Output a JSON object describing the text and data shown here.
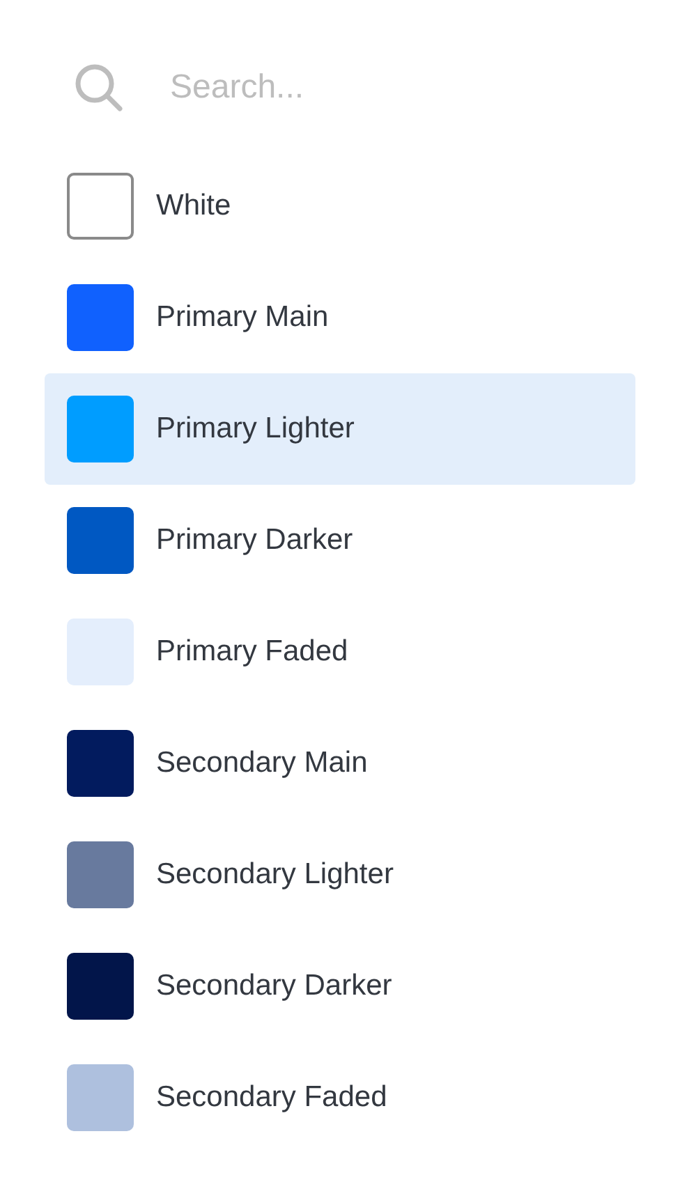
{
  "search": {
    "placeholder": "Search..."
  },
  "colors": [
    {
      "name": "White",
      "color": "#ffffff",
      "kind": "outlined",
      "selected": false
    },
    {
      "name": "Primary Main",
      "color": "#1061fe",
      "kind": "filled",
      "selected": false
    },
    {
      "name": "Primary Lighter",
      "color": "#009dff",
      "kind": "filled",
      "selected": true
    },
    {
      "name": "Primary Darker",
      "color": "#0058c2",
      "kind": "filled",
      "selected": false
    },
    {
      "name": "Primary Faded",
      "color": "#e4eefc",
      "kind": "filled",
      "selected": false
    },
    {
      "name": "Secondary Main",
      "color": "#021b5e",
      "kind": "filled",
      "selected": false
    },
    {
      "name": "Secondary Lighter",
      "color": "#687a9e",
      "kind": "filled",
      "selected": false
    },
    {
      "name": "Secondary Darker",
      "color": "#02154a",
      "kind": "filled",
      "selected": false
    },
    {
      "name": "Secondary Faded",
      "color": "#aec0de",
      "kind": "filled",
      "selected": false
    }
  ]
}
